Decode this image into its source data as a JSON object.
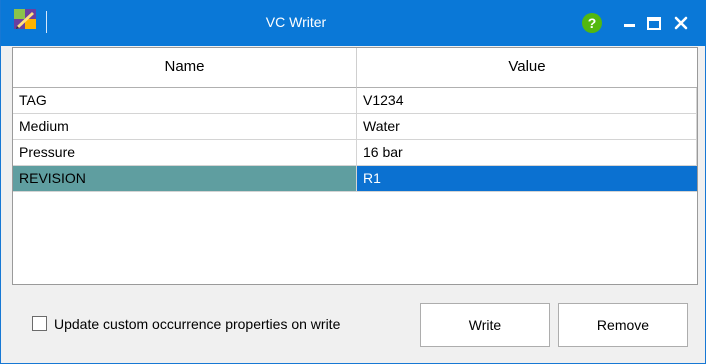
{
  "window": {
    "title": "VC Writer",
    "help_label": "?",
    "accent": "#0a78d7",
    "selected_name_bg": "#5f9ea0",
    "selected_value_bg": "#0b71d1"
  },
  "titlebar_icons": [
    "app-icon",
    "help-icon",
    "minimize-icon",
    "maximize-icon",
    "close-icon"
  ],
  "grid": {
    "columns": [
      "Name",
      "Value"
    ],
    "rows": [
      {
        "name": "TAG",
        "value": "V1234"
      },
      {
        "name": "Medium",
        "value": "Water"
      },
      {
        "name": "Pressure",
        "value": "16 bar"
      },
      {
        "name": "REVISION",
        "value": "R1",
        "selected": true
      }
    ]
  },
  "footer": {
    "checkbox_label": "Update custom occurrence properties on write",
    "checkbox_checked": false,
    "write_label": "Write",
    "remove_label": "Remove"
  }
}
